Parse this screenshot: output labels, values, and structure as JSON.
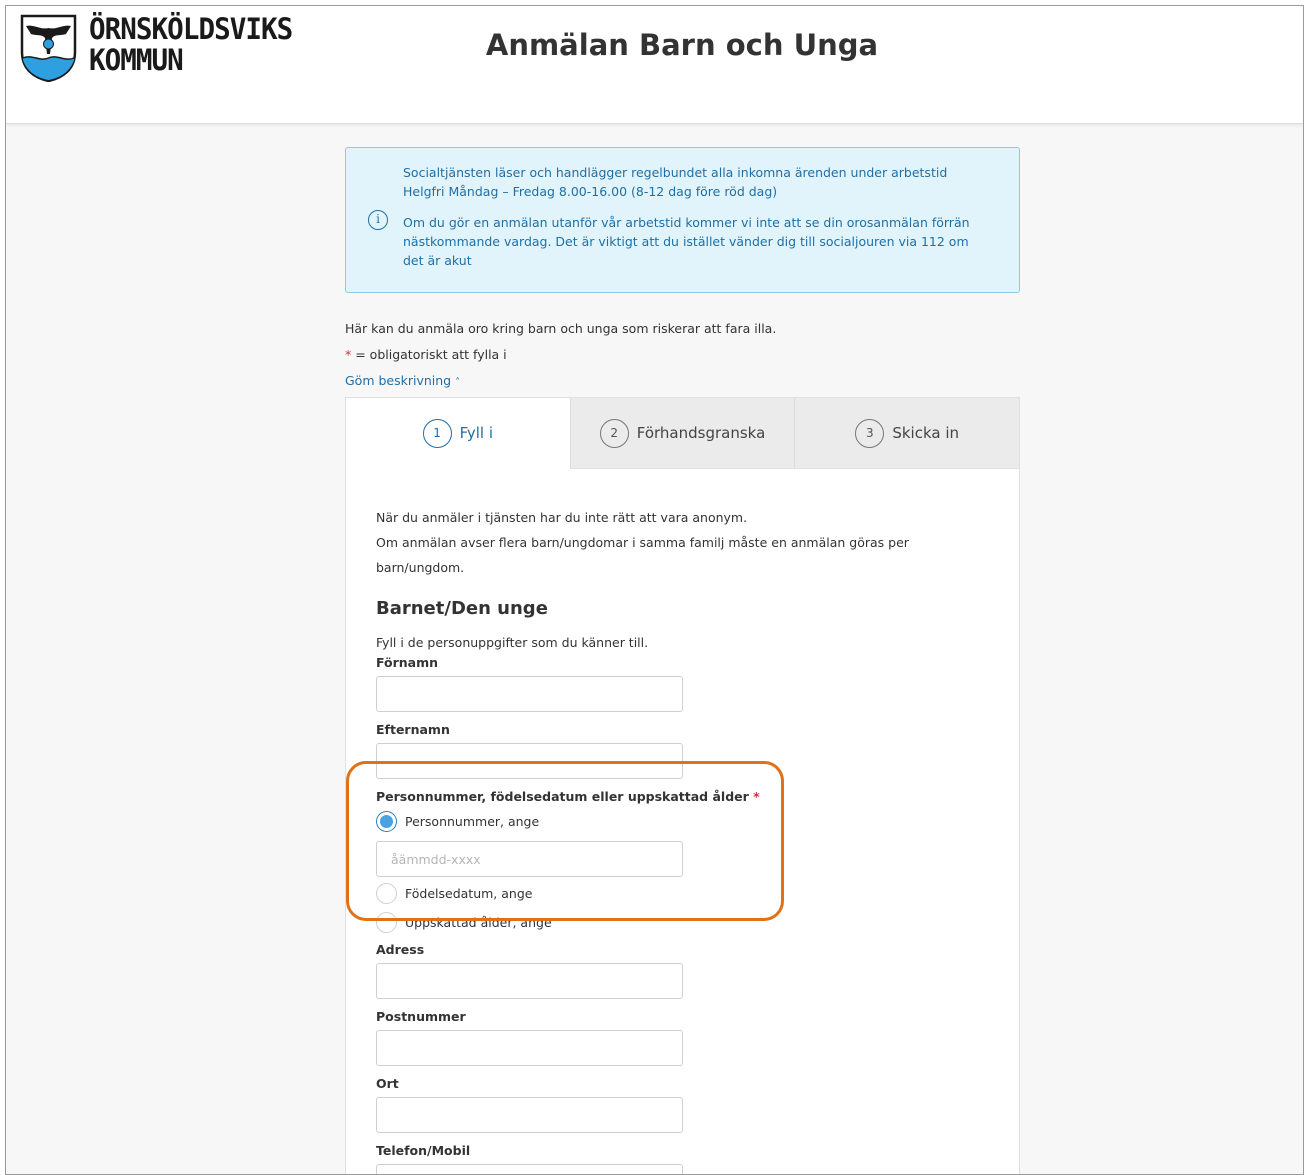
{
  "header": {
    "logo_line1": "ÖRNSKÖLDSVIKS",
    "logo_line2": "KOMMUN",
    "title": "Anmälan Barn och Unga"
  },
  "info": {
    "paragraph1": "Socialtjänsten läser och handlägger regelbundet alla inkomna ärenden under arbetstid Helgfri Måndag – Fredag 8.00-16.00 (8-12 dag före röd dag)",
    "paragraph2": "Om du gör en anmälan utanför vår arbetstid kommer vi inte att se din orosanmälan förrän nästkommande vardag. Det är viktigt att du istället vänder dig till socialjouren via 112 om det är akut",
    "icon": "info-icon"
  },
  "intro": {
    "text": "Här kan du anmäla oro kring barn och unga som riskerar att fara illa.",
    "required_star": "*",
    "required_text": " = obligatoriskt att fylla i",
    "toggle_label": "Göm beskrivning",
    "toggle_chevron": "˄"
  },
  "steps": [
    {
      "num": "1",
      "label": "Fyll i"
    },
    {
      "num": "2",
      "label": "Förhandsgranska"
    },
    {
      "num": "3",
      "label": "Skicka in"
    }
  ],
  "form": {
    "note1": "När du anmäler i tjänsten har du inte rätt att vara anonym.",
    "note2": "Om anmälan avser flera barn/ungdomar i samma familj måste en anmälan göras per barn/ungdom.",
    "section_title": "Barnet/Den unge",
    "section_hint": "Fyll i de personuppgifter som du känner till.",
    "fornamn_label": "Förnamn",
    "efternamn_label": "Efternamn",
    "id_label": "Personnummer, födelsedatum eller uppskattad ålder",
    "id_required": "*",
    "radio_personnummer": "Personnummer, ange",
    "personnummer_placeholder": "åämmdd-xxxx",
    "radio_fodelsedatum": "Födelsedatum, ange",
    "radio_alder": "Uppskattad ålder, ange",
    "adress_label": "Adress",
    "postnummer_label": "Postnummer",
    "ort_label": "Ort",
    "telefon_label": "Telefon/Mobil"
  }
}
